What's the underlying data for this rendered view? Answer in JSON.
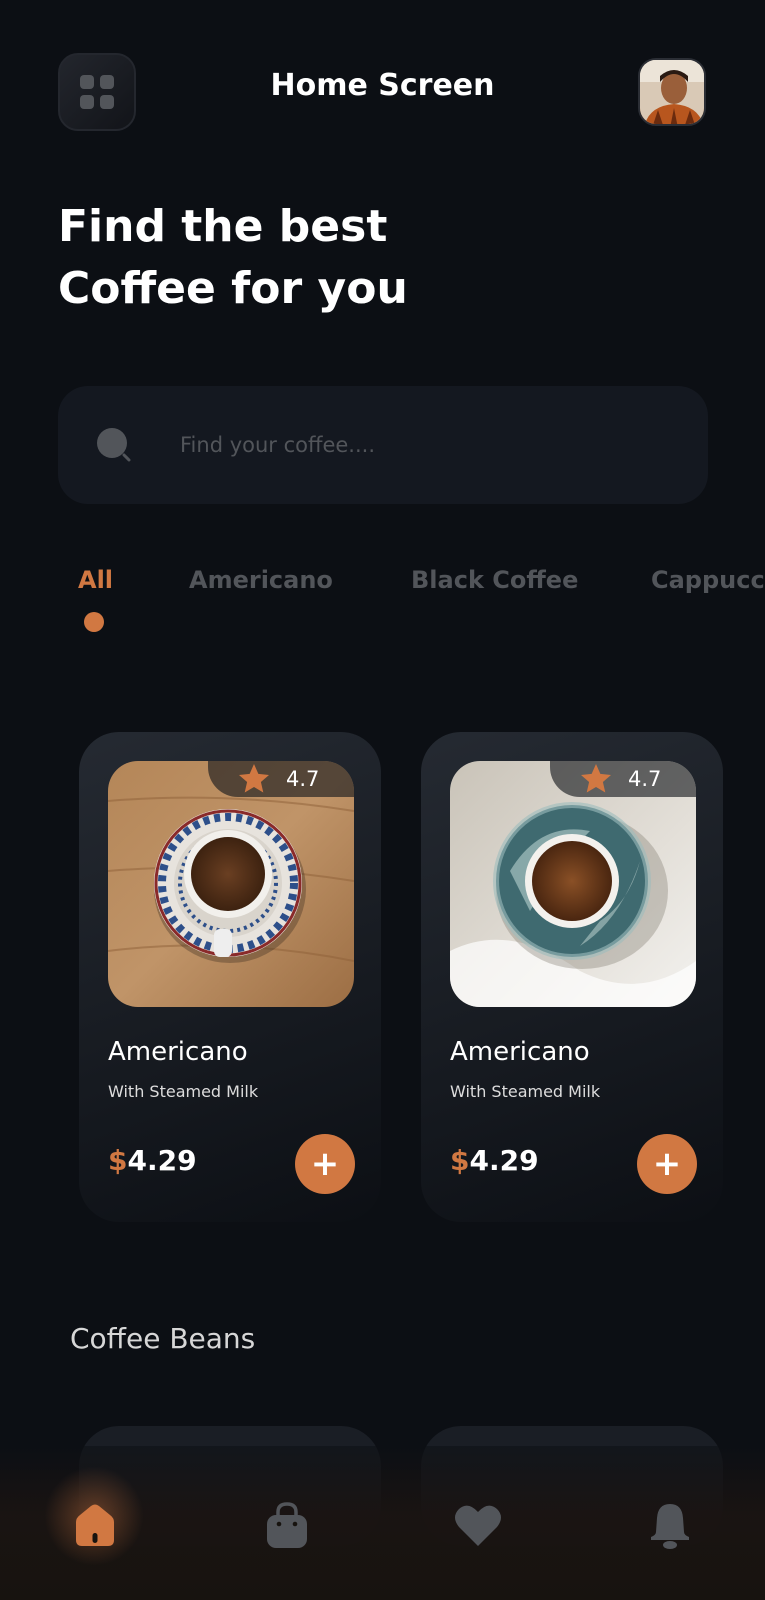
{
  "header": {
    "title": "Home Screen",
    "menu_icon": "grid-menu-icon",
    "avatar_icon": "profile-avatar"
  },
  "hero": {
    "line1": "Find the best",
    "line2": "Coffee for you"
  },
  "search": {
    "placeholder": "Find your coffee....",
    "value": "",
    "icon": "search-icon"
  },
  "categories": {
    "items": [
      "All",
      "Americano",
      "Black Coffee",
      "Cappuccino"
    ],
    "selected": "All"
  },
  "products": [
    {
      "rating": "4.7",
      "name": "Americano",
      "subtitle": "With Steamed Milk",
      "currency": "$",
      "price": "4.29",
      "add_label": "+"
    },
    {
      "rating": "4.7",
      "name": "Americano",
      "subtitle": "With Steamed Milk",
      "currency": "$",
      "price": "4.29",
      "add_label": "+"
    }
  ],
  "sections": {
    "beans_title": "Coffee Beans"
  },
  "bottom_nav": {
    "items": [
      "home-icon",
      "bag-icon",
      "heart-icon",
      "bell-icon"
    ],
    "active": "home-icon"
  },
  "colors": {
    "background": "#0c0f14",
    "accent": "#d17842",
    "muted": "#52555a",
    "card": "#1a1e25"
  }
}
